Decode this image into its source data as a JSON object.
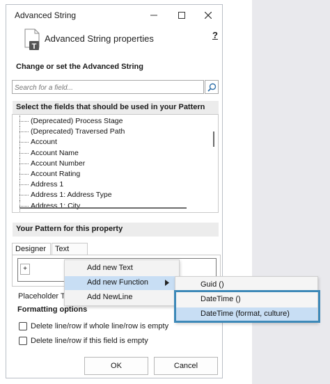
{
  "window": {
    "title": "Advanced String"
  },
  "header": {
    "label": "Advanced String properties",
    "help": "?",
    "icon": "string-property-icon"
  },
  "sections": {
    "change": "Change or set the Advanced String",
    "select": "Select the fields that should be used in your Pattern",
    "pattern": "Your Pattern for this property"
  },
  "search": {
    "placeholder": "Search for a field..."
  },
  "fields": [
    "(Deprecated) Process Stage",
    "(Deprecated) Traversed Path",
    "Account",
    "Account Name",
    "Account Number",
    "Account Rating",
    "Address 1",
    "Address 1: Address Type",
    "Address 1: City"
  ],
  "tabs": {
    "designer": "Designer",
    "text": "Text"
  },
  "designer": {
    "plus": "+"
  },
  "placeholder_label": "Placeholder Tex",
  "formatting": {
    "label": "Formatting options",
    "options": [
      "Delete line/row if whole line/row is empty",
      "Delete line/row if this field is empty"
    ]
  },
  "buttons": {
    "ok": "OK",
    "cancel": "Cancel"
  },
  "context_menu": {
    "items": [
      "Add new Text",
      "Add new Function",
      "Add NewLine"
    ],
    "submenu_arrow": "▶"
  },
  "submenu": {
    "items": [
      "Guid ()",
      "DateTime ()",
      "DateTime (format, culture)"
    ]
  },
  "colors": {
    "highlight_border": "#3d89b8",
    "menu_hover": "#c8def4"
  }
}
